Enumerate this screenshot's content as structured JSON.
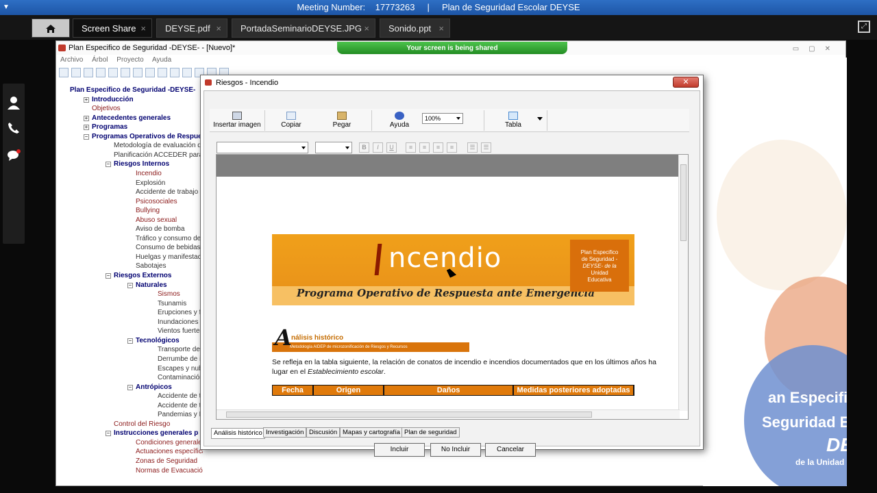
{
  "meeting": {
    "label": "Meeting Number:",
    "number": "17773263",
    "separator": "|",
    "title": "Plan de Seguridad Escolar DEYSE"
  },
  "tabs": [
    {
      "label": "Screen Share",
      "active": true
    },
    {
      "label": "DEYSE.pdf"
    },
    {
      "label": "PortadaSeminarioDEYSE.JPG"
    },
    {
      "label": "Sonido.ppt"
    }
  ],
  "tab_close": "×",
  "app": {
    "title": "Plan Especifico de Seguridad -DEYSE- - [Nuevo]*",
    "share_notice": "Your screen is being shared",
    "menu": [
      "Archivo",
      "Árbol",
      "Proyecto",
      "Ayuda"
    ]
  },
  "tree": [
    {
      "label": "Plan Especifico de Seguridad -DEYSE-",
      "style": "b"
    },
    {
      "label": "Introducción",
      "style": "b"
    },
    {
      "label": "Objetivos",
      "style": "r"
    },
    {
      "label": "Antecedentes generales",
      "style": "b"
    },
    {
      "label": "Programas",
      "style": "b"
    },
    {
      "label": "Programas Operativos de Respue",
      "style": "b"
    },
    {
      "label": "Metodología de evaluación de",
      "style": "g"
    },
    {
      "label": "Planificación ACCEDER para e",
      "style": "g"
    },
    {
      "label": "Riesgos Internos",
      "style": "b"
    },
    {
      "label": "Incendio",
      "style": "r"
    },
    {
      "label": "Explosión",
      "style": "g"
    },
    {
      "label": "Accidente de trabajo",
      "style": "g"
    },
    {
      "label": "Psicosociales",
      "style": "r"
    },
    {
      "label": "Bullying",
      "style": "r"
    },
    {
      "label": "Abuso sexual",
      "style": "r"
    },
    {
      "label": "Aviso de bomba",
      "style": "g"
    },
    {
      "label": "Tráfico y consumo de d",
      "style": "g"
    },
    {
      "label": "Consumo de bebidas al",
      "style": "g"
    },
    {
      "label": "Huelgas y manifestacio",
      "style": "g"
    },
    {
      "label": "Sabotajes",
      "style": "g"
    },
    {
      "label": "Riesgos Externos",
      "style": "b"
    },
    {
      "label": "Naturales",
      "style": "b"
    },
    {
      "label": "Sismos",
      "style": "r"
    },
    {
      "label": "Tsunamis",
      "style": "g"
    },
    {
      "label": "Erupciones y fe",
      "style": "g"
    },
    {
      "label": "Inundaciones",
      "style": "g"
    },
    {
      "label": "Vientos fuertes",
      "style": "g"
    },
    {
      "label": "Tecnológicos",
      "style": "b"
    },
    {
      "label": "Transporte de m",
      "style": "g"
    },
    {
      "label": "Derrumbe de in",
      "style": "g"
    },
    {
      "label": "Escapes y nub",
      "style": "g"
    },
    {
      "label": "Contaminación",
      "style": "g"
    },
    {
      "label": "Antrópicos",
      "style": "b"
    },
    {
      "label": "Accidente de tr",
      "style": "g"
    },
    {
      "label": "Accidente de tr",
      "style": "g"
    },
    {
      "label": "Pandemias y E",
      "style": "g"
    },
    {
      "label": "Control del Riesgo",
      "style": "r"
    },
    {
      "label": "Instrucciones generales p",
      "style": "b"
    },
    {
      "label": "Condiciones generales",
      "style": "r"
    },
    {
      "label": "Actuaciones específica",
      "style": "r"
    },
    {
      "label": "Zonas de Seguridad",
      "style": "r"
    },
    {
      "label": "Normas de Evacuación",
      "style": "r"
    }
  ],
  "dialog": {
    "title": "Riesgos - Incendio",
    "ribbon": {
      "insert": "Insertar imagen",
      "copy": "Copiar",
      "paste": "Pegar",
      "help": "Ayuda",
      "zoom": "100%",
      "table": "Tabla"
    },
    "format": {
      "bold": "B",
      "italic": "I",
      "underline": "U"
    },
    "doc": {
      "banner_title": "ncendio",
      "banner_subtitle": "Programa Operativo de Respuesta ante Emergencia",
      "badge_lines": [
        "Plan Especifico",
        "de Seguridad -",
        "DEYSE- de la",
        "Unidad",
        "Educativa"
      ],
      "section_title": "nálisis histórico",
      "section_letter": "A",
      "section_sub": "Metodología AIDEP de microzonificación de Riesgos y Recursos",
      "paragraph_1": "Se refleja en la tabla siguiente, la relación de conatos de incendio e incendios documentados que en los últimos años ha",
      "paragraph_2a": "lugar en el ",
      "paragraph_2b": "Establecimiento escolar",
      "paragraph_2c": ".",
      "table_headers": [
        "Fecha",
        "Origen",
        "Daños",
        "Medidas posteriores adoptadas"
      ]
    },
    "bottom_tabs": [
      "Análisis histórico",
      "Investigación",
      "Discusión",
      "Mapas y cartografía",
      "Plan de seguridad"
    ],
    "buttons": {
      "include": "Incluir",
      "not_include": "No Incluir",
      "cancel": "Cancelar"
    }
  },
  "background": {
    "lines": [
      "an Especifico",
      "Seguridad Escolar",
      "DEYSE",
      "de la Unidad Educativa"
    ]
  }
}
